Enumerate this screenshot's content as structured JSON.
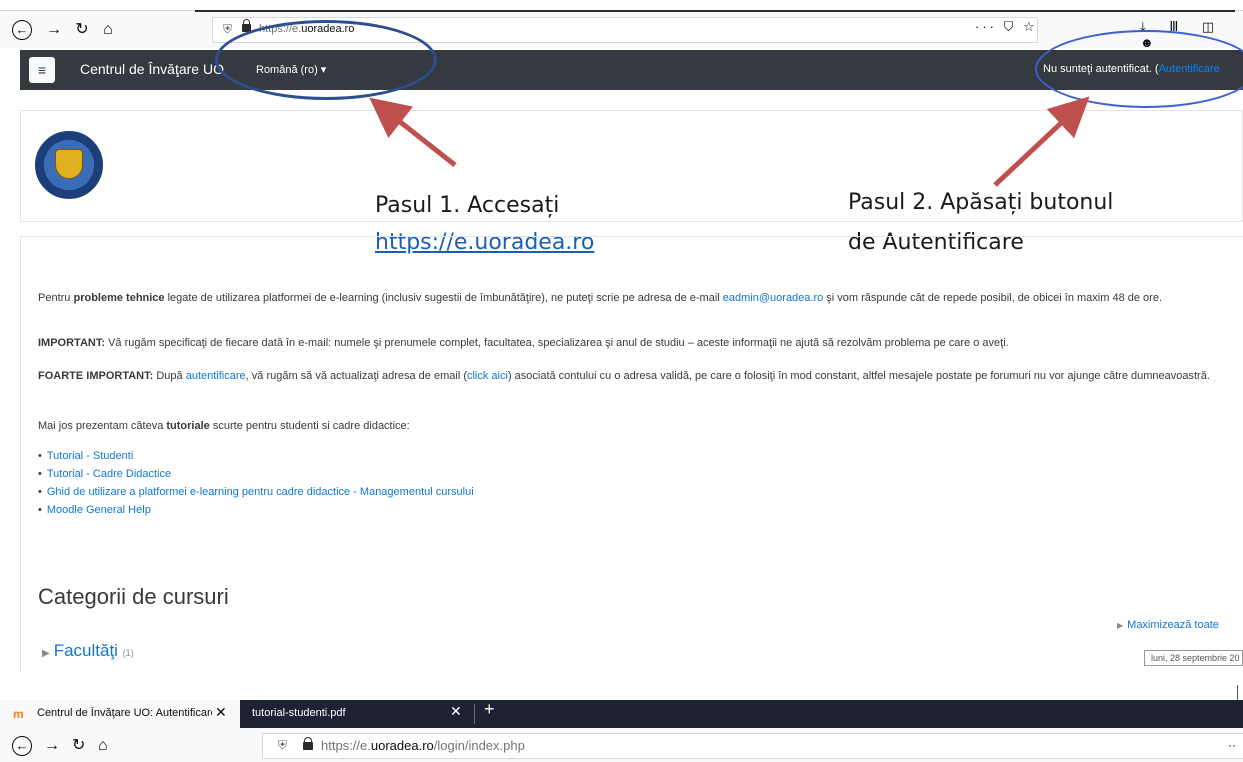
{
  "browser_top": {
    "url_prefix": "https://e.",
    "url_domain": "uoradea.ro",
    "url_actions": "··· ⛉ ☆",
    "toolbar_icons": "⤓ Ⅲ ◫ ☻"
  },
  "navbar": {
    "menu_icon": "≡",
    "site_name": "Centrul de Învăţare UO",
    "language": "Română (ro) ▾",
    "not_logged_in": "Nu sunteţi autentificat. (",
    "login_link": "Autentificare"
  },
  "annotations": {
    "step1_text": "Pasul 1. Accesați",
    "step1_link": "https://e.uoradea.ro",
    "step2_line1": "Pasul 2. Apăsați butonul",
    "step2_line2": "de Autentificare"
  },
  "content": {
    "p1_a": "Pentru ",
    "p1_bold": "probleme tehnice",
    "p1_b": " legate de utilizarea platformei de e-learning (inclusiv sugestii de îmbunătăţire), ne puteţi scrie pe adresa de e-mail ",
    "p1_email": "eadmin@uoradea.ro",
    "p1_c": " şi vom răspunde cât de repede posibil, de obicei în maxim 48 de ore.",
    "p2_bold": "IMPORTANT:",
    "p2_text": " Vă rugăm specificaţi de fiecare dată în e-mail: numele şi prenumele complet, facultatea, specializarea şi anul de studiu – aceste informaţii ne ajută să rezolvăm problema pe care o aveţi.",
    "p3_bold": "FOARTE IMPORTANT:",
    "p3_a": " După ",
    "p3_link1": "autentificare",
    "p3_b": ", vă rugăm să vă actualizaţi adresa de email (",
    "p3_link2": "click aici",
    "p3_c": ") asociată contului cu o adresa validă, pe care o folosiţi în mod constant, altfel mesajele postate pe forumuri nu vor ajunge către dumneavoastră.",
    "p4_a": "Mai jos prezentam câteva ",
    "p4_bold": "tutoriale",
    "p4_b": " scurte pentru studenti si cadre didactice:",
    "tutorials": [
      "Tutorial - Studenti",
      "Tutorial - Cadre Didactice",
      "Ghid de utilizare a platformei e-learning pentru cadre didactice - Managementul cursului",
      "Moodle General Help"
    ],
    "categories_heading": "Categorii de cursuri",
    "expand_all": "Maximizează toate",
    "faculty": "Facultăţi",
    "faculty_count": "(1)",
    "date": "luni, 28 septembrie 20"
  },
  "tabs": {
    "tab1_title": "Centrul de Învăţare UO: Autentificare",
    "tab2_title": "tutorial-studenti.pdf",
    "close": "✕",
    "new_tab": "+"
  },
  "browser_bottom": {
    "url_prefix": "https://e.",
    "url_domain": "uoradea.ro",
    "url_path": "/login/index.php",
    "more": "··"
  }
}
